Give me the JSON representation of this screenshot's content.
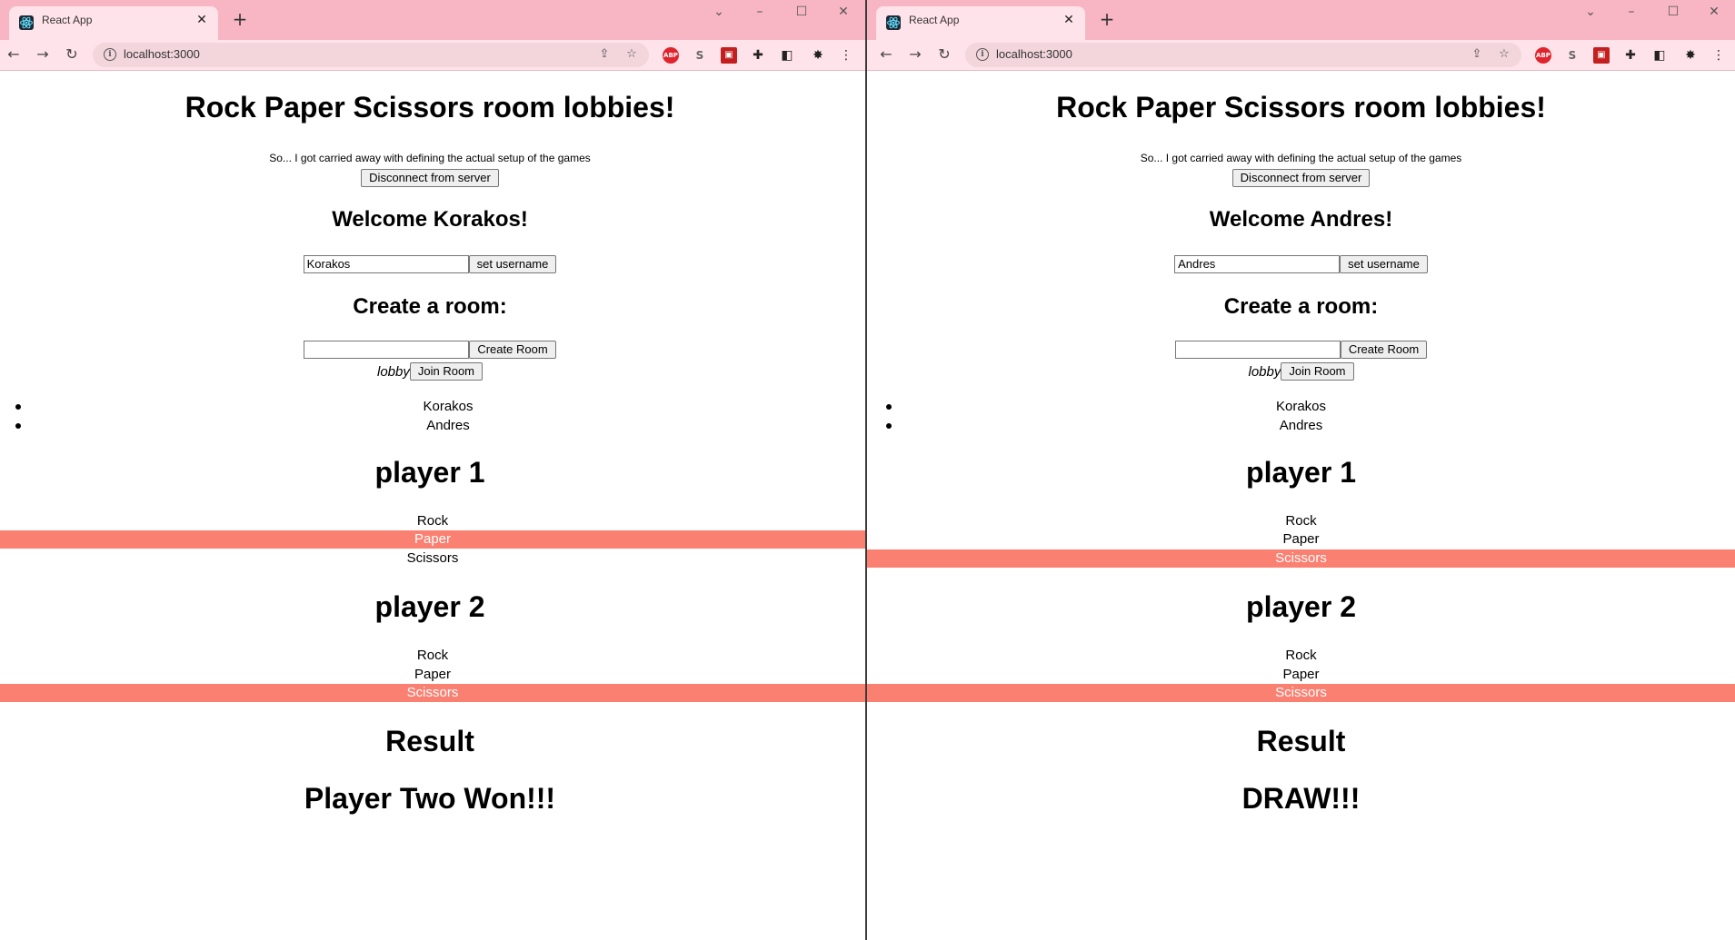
{
  "browser": {
    "tab_title": "React App",
    "url": "localhost:3000",
    "icons": {
      "back": "arrow-left-icon",
      "forward": "arrow-right-icon",
      "reload": "reload-icon",
      "share": "share-icon",
      "bookmark": "star-icon",
      "extensions": [
        "adblock-icon",
        "skype-icon",
        "red-extension-icon",
        "puzzle-icon",
        "side-panel-icon",
        "bug-extension-icon",
        "menu-icon"
      ]
    },
    "ext_abp_text": "ABP",
    "ext_s_text": "S"
  },
  "page": {
    "heading": "Rock Paper Scissors room lobbies!",
    "subtitle": "So... I got carried away with defining the actual setup of the games",
    "disconnect_label": "Disconnect from server",
    "set_username_label": "set username",
    "create_room_heading": "Create a room:",
    "create_room_label": "Create Room",
    "lobby_label": "lobby",
    "join_room_label": "Join Room",
    "player1_heading": "player 1",
    "player2_heading": "player 2",
    "choices": [
      "Rock",
      "Paper",
      "Scissors"
    ],
    "result_heading": "Result",
    "selected_color": "#fa8072"
  },
  "windows": [
    {
      "welcome": "Welcome Korakos!",
      "username_value": "Korakos",
      "players_list": [
        "Korakos",
        "Andres"
      ],
      "player1_selected": "Paper",
      "player2_selected": "Scissors",
      "result": "Player Two Won!!!"
    },
    {
      "welcome": "Welcome Andres!",
      "username_value": "Andres",
      "players_list": [
        "Korakos",
        "Andres"
      ],
      "player1_selected": "Scissors",
      "player2_selected": "Scissors",
      "result": "DRAW!!!"
    }
  ]
}
